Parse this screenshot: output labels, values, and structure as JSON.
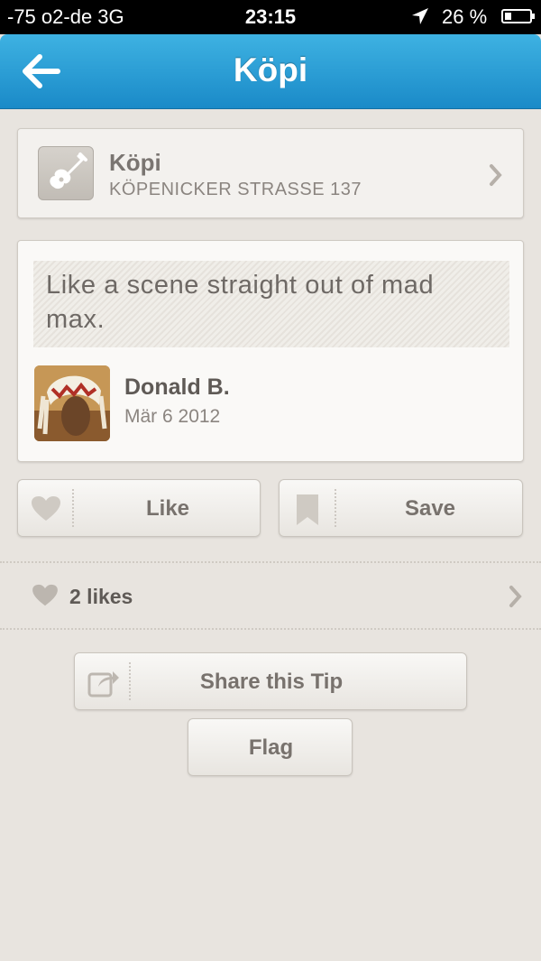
{
  "status_bar": {
    "carrier": "-75 o2-de  3G",
    "time": "23:15",
    "battery": "26 %",
    "battery_level": 0.26
  },
  "nav": {
    "title": "Köpi",
    "back_icon": "back-arrow-icon"
  },
  "venue": {
    "name": "Köpi",
    "address": "KÖPENICKER STRASSE 137",
    "icon": "guitar-icon"
  },
  "tip": {
    "text": "Like a scene straight out of mad max.",
    "author": "Donald B.",
    "date": "Mär 6 2012"
  },
  "actions": {
    "like_label": "Like",
    "save_label": "Save"
  },
  "likes": {
    "label": "2 likes"
  },
  "share": {
    "label": "Share this Tip"
  },
  "flag": {
    "label": "Flag"
  },
  "colors": {
    "nav_accent": "#2a9fd8",
    "background": "#e8e4df"
  }
}
